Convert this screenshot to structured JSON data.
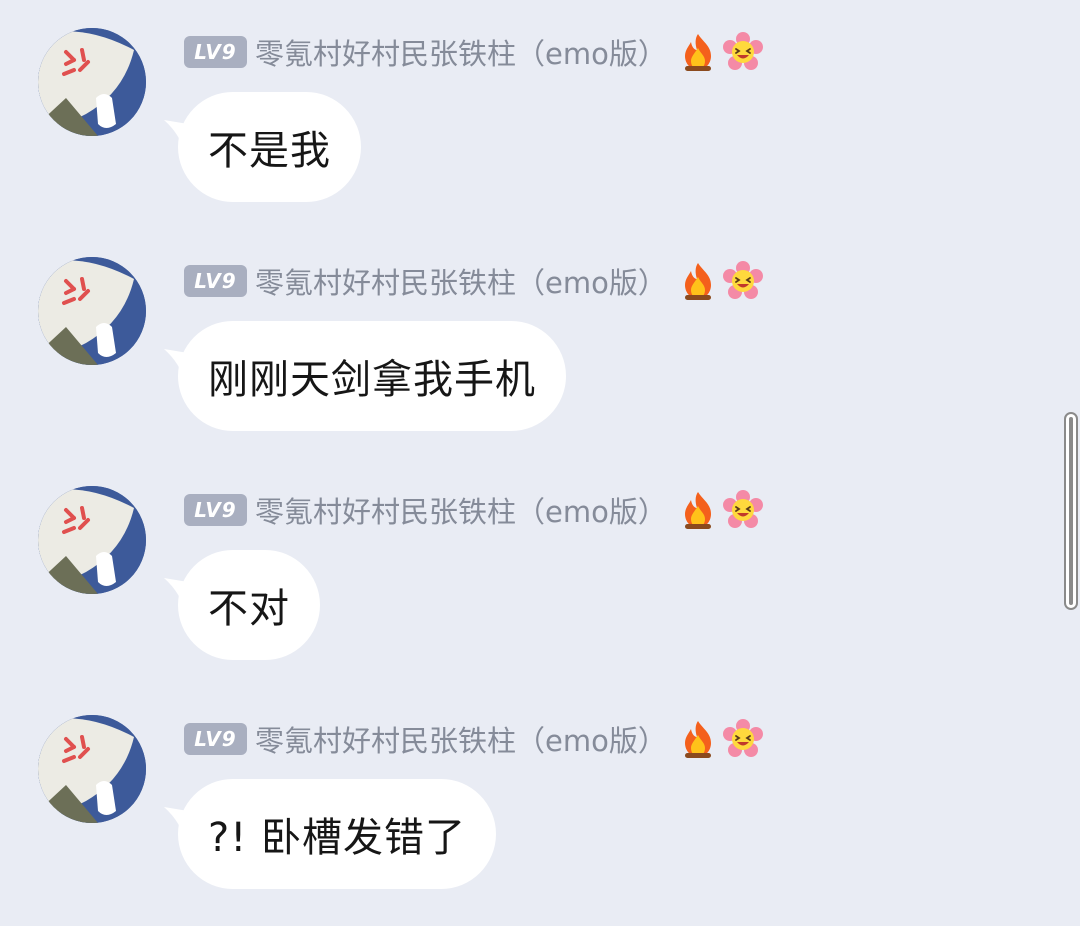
{
  "messages": [
    {
      "level": "LV9",
      "username": "零氪村好村民张铁柱（emo版）",
      "badges": [
        "flame-icon",
        "smiling-flower-icon"
      ],
      "text": "不是我"
    },
    {
      "level": "LV9",
      "username": "零氪村好村民张铁柱（emo版）",
      "badges": [
        "flame-icon",
        "smiling-flower-icon"
      ],
      "text": "刚刚天剑拿我手机"
    },
    {
      "level": "LV9",
      "username": "零氪村好村民张铁柱（emo版）",
      "badges": [
        "flame-icon",
        "smiling-flower-icon"
      ],
      "text": "不对"
    },
    {
      "level": "LV9",
      "username": "零氪村好村民张铁柱（emo版）",
      "badges": [
        "flame-icon",
        "smiling-flower-icon"
      ],
      "text": "?! 卧槽发错了"
    }
  ],
  "colors": {
    "background": "#e9ecf4",
    "bubble": "#ffffff",
    "level_badge": "#a9afc0",
    "username": "#858b99",
    "message_text": "#161616",
    "avatar_blue": "#3d5a9a",
    "anger_mark": "#e0504f"
  }
}
